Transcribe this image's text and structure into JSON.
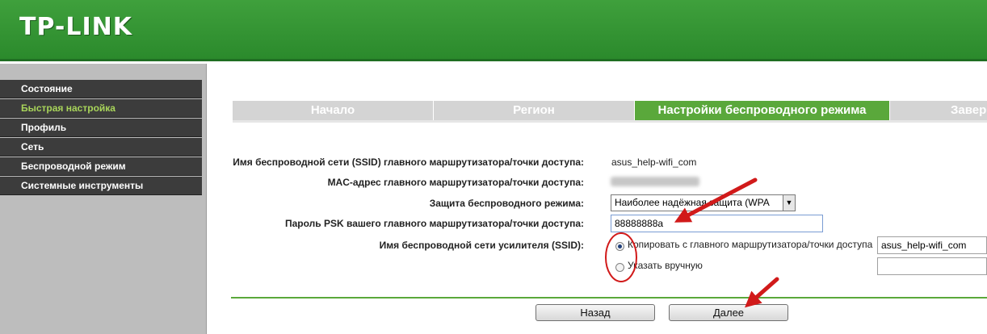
{
  "brand": {
    "logo_text": "TP-LINK"
  },
  "sidebar": {
    "items": [
      {
        "label": "Состояние"
      },
      {
        "label": "Быстрая настройка"
      },
      {
        "label": "Профиль"
      },
      {
        "label": "Сеть"
      },
      {
        "label": "Беспроводной режим"
      },
      {
        "label": "Системные инструменты"
      }
    ],
    "active_color": "#a8d45a"
  },
  "steps": [
    {
      "label": "Начало"
    },
    {
      "label": "Регион"
    },
    {
      "label": "Настройки беспроводного режима"
    },
    {
      "label": "Завер"
    }
  ],
  "form": {
    "ssid_label": "Имя беспроводной сети (SSID) главного маршрутизатора/точки доступа:",
    "ssid_value": "asus_help-wifi_com",
    "mac_label": "MAC-адрес главного маршрутизатора/точки доступа:",
    "security_label": "Защита беспроводного режима:",
    "security_value": "Наиболее надёжная защита (WPA",
    "psk_label": "Пароль PSK вашего главного маршрутизатора/точки доступа:",
    "psk_value": "88888888a",
    "ext_ssid_label": "Имя беспроводной сети усилителя (SSID):",
    "radio_copy_label": "Копировать с главного маршрутизатора/точки доступа",
    "radio_copy_value": "asus_help-wifi_com",
    "radio_manual_label": "Указать вручную"
  },
  "buttons": {
    "back_label": "Назад",
    "next_label": "Далее"
  },
  "colors": {
    "header_green": "#2b8a2c",
    "tab_active": "#5aa83b",
    "sidebar_bg": "#3c3c3c",
    "annotation_red": "#d11a1a"
  },
  "icons": {
    "select_arrow": "chevron-down-icon",
    "annotation_arrows": "red-arrow-icon"
  }
}
